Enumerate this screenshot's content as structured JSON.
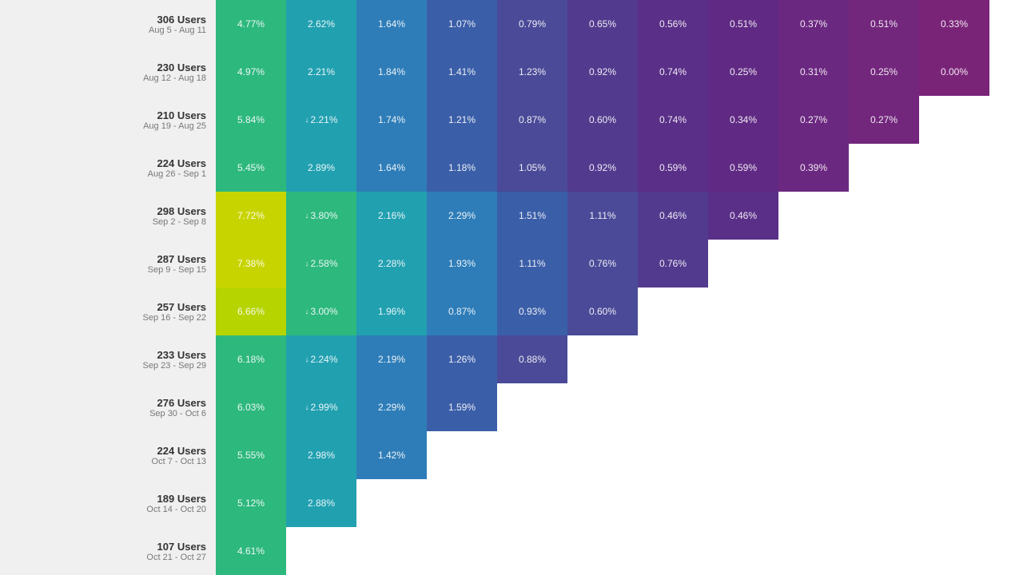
{
  "rows": [
    {
      "users": "306",
      "label": "Users",
      "dates": "Aug 5 - Aug 11",
      "cells": [
        {
          "value": "4.77%",
          "arrow": false,
          "bg": "#2db87d"
        },
        {
          "value": "2.62%",
          "arrow": false,
          "bg": "#21a0b0"
        },
        {
          "value": "1.64%",
          "arrow": false,
          "bg": "#2e7db8"
        },
        {
          "value": "1.07%",
          "arrow": false,
          "bg": "#3b5ea8"
        },
        {
          "value": "0.79%",
          "arrow": false,
          "bg": "#4a4a98"
        },
        {
          "value": "0.65%",
          "arrow": false,
          "bg": "#523a8e"
        },
        {
          "value": "0.56%",
          "arrow": false,
          "bg": "#5a2f88"
        },
        {
          "value": "0.51%",
          "arrow": false,
          "bg": "#602a84"
        },
        {
          "value": "0.37%",
          "arrow": false,
          "bg": "#6b2880"
        },
        {
          "value": "0.51%",
          "arrow": false,
          "bg": "#72267c"
        },
        {
          "value": "0.33%",
          "arrow": false,
          "bg": "#7a2478"
        }
      ]
    },
    {
      "users": "230",
      "label": "Users",
      "dates": "Aug 12 - Aug 18",
      "cells": [
        {
          "value": "4.97%",
          "arrow": false,
          "bg": "#2db87d"
        },
        {
          "value": "2.21%",
          "arrow": false,
          "bg": "#21a0b0"
        },
        {
          "value": "1.84%",
          "arrow": false,
          "bg": "#2e7db8"
        },
        {
          "value": "1.41%",
          "arrow": false,
          "bg": "#3b5ea8"
        },
        {
          "value": "1.23%",
          "arrow": false,
          "bg": "#4a4a98"
        },
        {
          "value": "0.92%",
          "arrow": false,
          "bg": "#523a8e"
        },
        {
          "value": "0.74%",
          "arrow": false,
          "bg": "#5a2f88"
        },
        {
          "value": "0.25%",
          "arrow": false,
          "bg": "#602a84"
        },
        {
          "value": "0.31%",
          "arrow": false,
          "bg": "#6b2880"
        },
        {
          "value": "0.25%",
          "arrow": false,
          "bg": "#72267c"
        },
        {
          "value": "0.00%",
          "arrow": false,
          "bg": "#7a2478"
        }
      ]
    },
    {
      "users": "210",
      "label": "Users",
      "dates": "Aug 19 - Aug 25",
      "cells": [
        {
          "value": "5.84%",
          "arrow": false,
          "bg": "#2db87d"
        },
        {
          "value": "2.21%",
          "arrow": true,
          "bg": "#21a0b0"
        },
        {
          "value": "1.74%",
          "arrow": false,
          "bg": "#2e7db8"
        },
        {
          "value": "1.21%",
          "arrow": false,
          "bg": "#3b5ea8"
        },
        {
          "value": "0.87%",
          "arrow": false,
          "bg": "#4a4a98"
        },
        {
          "value": "0.60%",
          "arrow": false,
          "bg": "#523a8e"
        },
        {
          "value": "0.74%",
          "arrow": false,
          "bg": "#5a2f88"
        },
        {
          "value": "0.34%",
          "arrow": false,
          "bg": "#602a84"
        },
        {
          "value": "0.27%",
          "arrow": false,
          "bg": "#6b2880"
        },
        {
          "value": "0.27%",
          "arrow": false,
          "bg": "#72267c"
        }
      ]
    },
    {
      "users": "224",
      "label": "Users",
      "dates": "Aug 26 - Sep 1",
      "cells": [
        {
          "value": "5.45%",
          "arrow": false,
          "bg": "#2db87d"
        },
        {
          "value": "2.89%",
          "arrow": false,
          "bg": "#21a0b0"
        },
        {
          "value": "1.64%",
          "arrow": false,
          "bg": "#2e7db8"
        },
        {
          "value": "1.18%",
          "arrow": false,
          "bg": "#3b5ea8"
        },
        {
          "value": "1.05%",
          "arrow": false,
          "bg": "#4a4a98"
        },
        {
          "value": "0.92%",
          "arrow": false,
          "bg": "#523a8e"
        },
        {
          "value": "0.59%",
          "arrow": false,
          "bg": "#5a2f88"
        },
        {
          "value": "0.59%",
          "arrow": false,
          "bg": "#602a84"
        },
        {
          "value": "0.39%",
          "arrow": false,
          "bg": "#6b2880"
        }
      ]
    },
    {
      "users": "298",
      "label": "Users",
      "dates": "Sep 2 - Sep 8",
      "cells": [
        {
          "value": "7.72%",
          "arrow": false,
          "bg": "#c8d400"
        },
        {
          "value": "3.80%",
          "arrow": true,
          "bg": "#2db87d"
        },
        {
          "value": "2.16%",
          "arrow": false,
          "bg": "#21a0b0"
        },
        {
          "value": "2.29%",
          "arrow": false,
          "bg": "#2e7db8"
        },
        {
          "value": "1.51%",
          "arrow": false,
          "bg": "#3b5ea8"
        },
        {
          "value": "1.11%",
          "arrow": false,
          "bg": "#4a4a98"
        },
        {
          "value": "0.46%",
          "arrow": false,
          "bg": "#523a8e"
        },
        {
          "value": "0.46%",
          "arrow": false,
          "bg": "#5a2f88"
        }
      ]
    },
    {
      "users": "287",
      "label": "Users",
      "dates": "Sep 9 - Sep 15",
      "cells": [
        {
          "value": "7.38%",
          "arrow": false,
          "bg": "#c8d400"
        },
        {
          "value": "2.58%",
          "arrow": true,
          "bg": "#2db87d"
        },
        {
          "value": "2.28%",
          "arrow": false,
          "bg": "#21a0b0"
        },
        {
          "value": "1.93%",
          "arrow": false,
          "bg": "#2e7db8"
        },
        {
          "value": "1.11%",
          "arrow": false,
          "bg": "#3b5ea8"
        },
        {
          "value": "0.76%",
          "arrow": false,
          "bg": "#4a4a98"
        },
        {
          "value": "0.76%",
          "arrow": false,
          "bg": "#523a8e"
        }
      ]
    },
    {
      "users": "257",
      "label": "Users",
      "dates": "Sep 16 - Sep 22",
      "cells": [
        {
          "value": "6.66%",
          "arrow": false,
          "bg": "#b5d400"
        },
        {
          "value": "3.00%",
          "arrow": true,
          "bg": "#2db87d"
        },
        {
          "value": "1.96%",
          "arrow": false,
          "bg": "#21a0b0"
        },
        {
          "value": "0.87%",
          "arrow": false,
          "bg": "#2e7db8"
        },
        {
          "value": "0.93%",
          "arrow": false,
          "bg": "#3b5ea8"
        },
        {
          "value": "0.60%",
          "arrow": false,
          "bg": "#4a4a98"
        }
      ]
    },
    {
      "users": "233",
      "label": "Users",
      "dates": "Sep 23 - Sep 29",
      "cells": [
        {
          "value": "6.18%",
          "arrow": false,
          "bg": "#2db87d"
        },
        {
          "value": "2.24%",
          "arrow": true,
          "bg": "#21a0b0"
        },
        {
          "value": "2.19%",
          "arrow": false,
          "bg": "#2e7db8"
        },
        {
          "value": "1.26%",
          "arrow": false,
          "bg": "#3b5ea8"
        },
        {
          "value": "0.88%",
          "arrow": false,
          "bg": "#4a4a98"
        }
      ]
    },
    {
      "users": "276",
      "label": "Users",
      "dates": "Sep 30 - Oct 6",
      "cells": [
        {
          "value": "6.03%",
          "arrow": false,
          "bg": "#2db87d"
        },
        {
          "value": "2.99%",
          "arrow": true,
          "bg": "#21a0b0"
        },
        {
          "value": "2.29%",
          "arrow": false,
          "bg": "#2e7db8"
        },
        {
          "value": "1.59%",
          "arrow": false,
          "bg": "#3b5ea8"
        }
      ]
    },
    {
      "users": "224",
      "label": "Users",
      "dates": "Oct 7 - Oct 13",
      "cells": [
        {
          "value": "5.55%",
          "arrow": false,
          "bg": "#2db87d"
        },
        {
          "value": "2.98%",
          "arrow": false,
          "bg": "#21a0b0"
        },
        {
          "value": "1.42%",
          "arrow": false,
          "bg": "#2e7db8"
        }
      ]
    },
    {
      "users": "189",
      "label": "Users",
      "dates": "Oct 14 - Oct 20",
      "cells": [
        {
          "value": "5.12%",
          "arrow": false,
          "bg": "#2db87d"
        },
        {
          "value": "2.88%",
          "arrow": false,
          "bg": "#21a0b0"
        }
      ]
    },
    {
      "users": "107",
      "label": "Users",
      "dates": "Oct 21 - Oct 27",
      "cells": [
        {
          "value": "4.61%",
          "arrow": false,
          "bg": "#2db87d"
        }
      ]
    }
  ]
}
